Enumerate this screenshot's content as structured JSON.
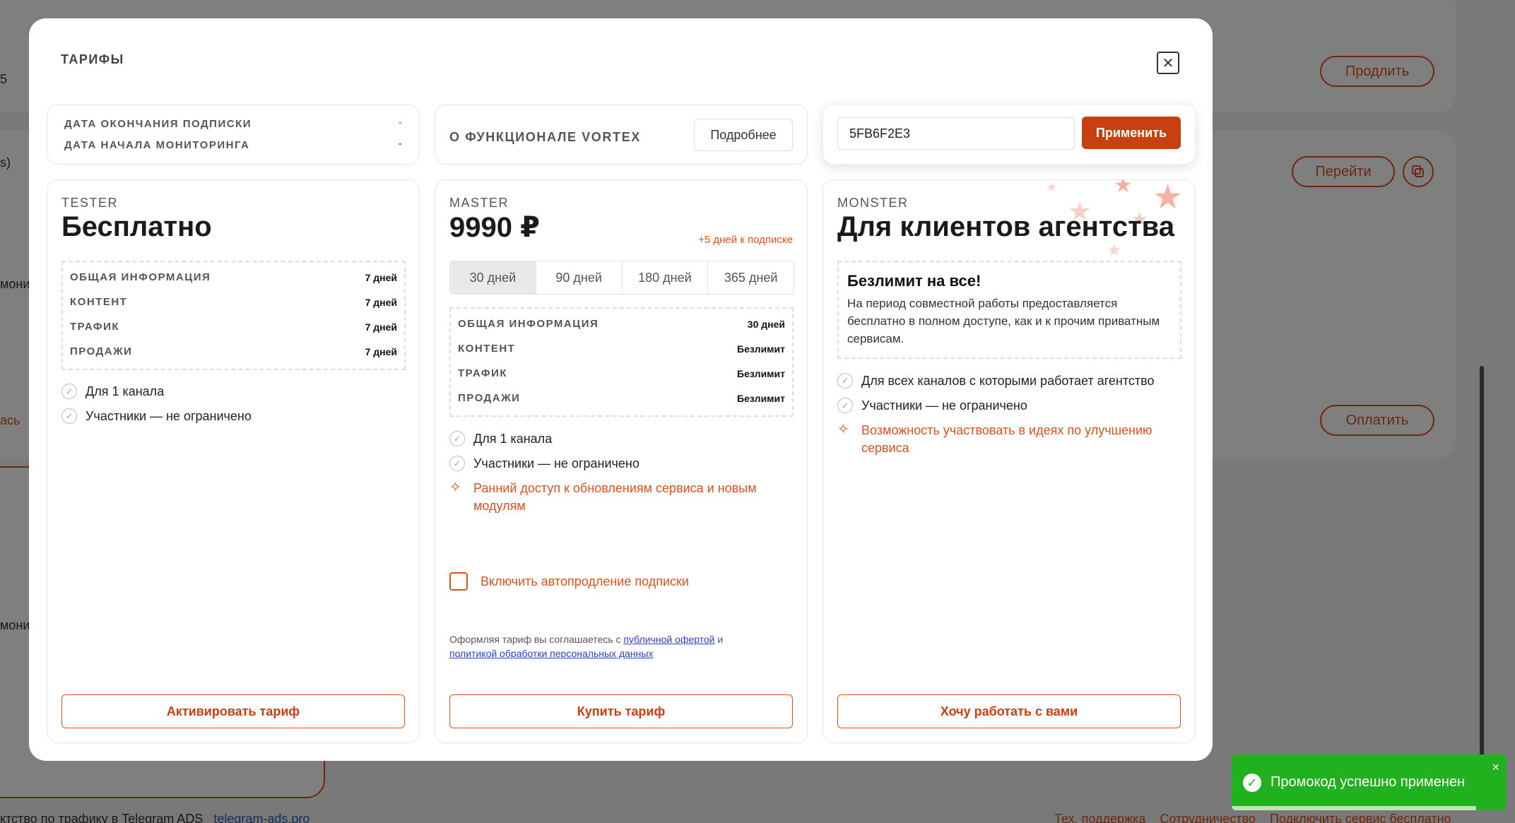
{
  "background": {
    "buttons": [
      "Продлить",
      "Перейти",
      "Оплатить"
    ],
    "fragments": [
      "5",
      "s)",
      "монит",
      "ась",
      "монит"
    ],
    "footer_left": "ктство по трафику в Telegram ADS",
    "footer_link": "telegram-ads.pro",
    "footer_links": [
      "Тех. поддержка",
      "Сотрудничество",
      "Подключить сервис бесплатно"
    ]
  },
  "modal": {
    "title": "ТАРИФЫ",
    "close_icon": "close-icon"
  },
  "subscription": {
    "end_label": "ДАТА ОКОНЧАНИЯ ПОДПИСКИ",
    "end_value": "-",
    "start_label": "ДАТА НАЧАЛА МОНИТОРИНГА",
    "start_value": "-"
  },
  "features": {
    "title": "О ФУНКЦИОНАЛЕ VORTEX",
    "more_label": "Подробнее"
  },
  "promo": {
    "value": "5FB6F2E3",
    "apply_label": "Применить"
  },
  "plans": {
    "tester": {
      "label": "TESTER",
      "price": "Бесплатно",
      "rows": [
        {
          "k": "ОБЩАЯ ИНФОРМАЦИЯ",
          "v": "7 дней"
        },
        {
          "k": "КОНТЕНТ",
          "v": "7 дней"
        },
        {
          "k": "ТРАФИК",
          "v": "7 дней"
        },
        {
          "k": "ПРОДАЖИ",
          "v": "7 дней"
        }
      ],
      "checks": [
        "Для 1 канала",
        "Участники — не ограничено"
      ],
      "button": "Активировать тариф"
    },
    "master": {
      "label": "MASTER",
      "price": "9990 ₽",
      "bonus": "+5 дней к подписке",
      "periods": [
        "30 дней",
        "90 дней",
        "180 дней",
        "365 дней"
      ],
      "active_period": "30 дней",
      "rows": [
        {
          "k": "ОБЩАЯ ИНФОРМАЦИЯ",
          "v": "30 дней"
        },
        {
          "k": "КОНТЕНТ",
          "v": "Безлимит"
        },
        {
          "k": "ТРАФИК",
          "v": "Безлимит"
        },
        {
          "k": "ПРОДАЖИ",
          "v": "Безлимит"
        }
      ],
      "checks": [
        "Для 1 канала",
        "Участники — не ограничено"
      ],
      "extra_line1": "Ранний доступ к обновлениям сервиса и новым",
      "extra_line2": "модулям",
      "autorenew": "Включить автопродление подписки",
      "terms_prefix": "Оформляя тариф вы соглашаетесь с ",
      "terms_link1": "публичной офертой",
      "terms_mid": " и",
      "terms_link2": "политикой обработки персональных данных",
      "button": "Купить тариф"
    },
    "monster": {
      "label": "MONSTER",
      "price": "Для клиентов агентства",
      "box_title": "Безлимит на все!",
      "box_text": "На период совместной работы предоставляется бесплатно в полном доступе, как и к прочим приватным сервисам.",
      "checks": [
        "Для всех каналов с которыми работает агентство",
        "Участники — не ограничено"
      ],
      "extra_line1": "Возможность участвовать в идеях по улучшению",
      "extra_line2": "сервиса",
      "button": "Хочу работать с вами"
    }
  },
  "toast": {
    "message": "Промокод успешно применен",
    "close": "×",
    "progress": 0.89,
    "color": "#21b11e"
  },
  "colors": {
    "accent": "#e0501c",
    "accent_dark": "#c8400f"
  }
}
